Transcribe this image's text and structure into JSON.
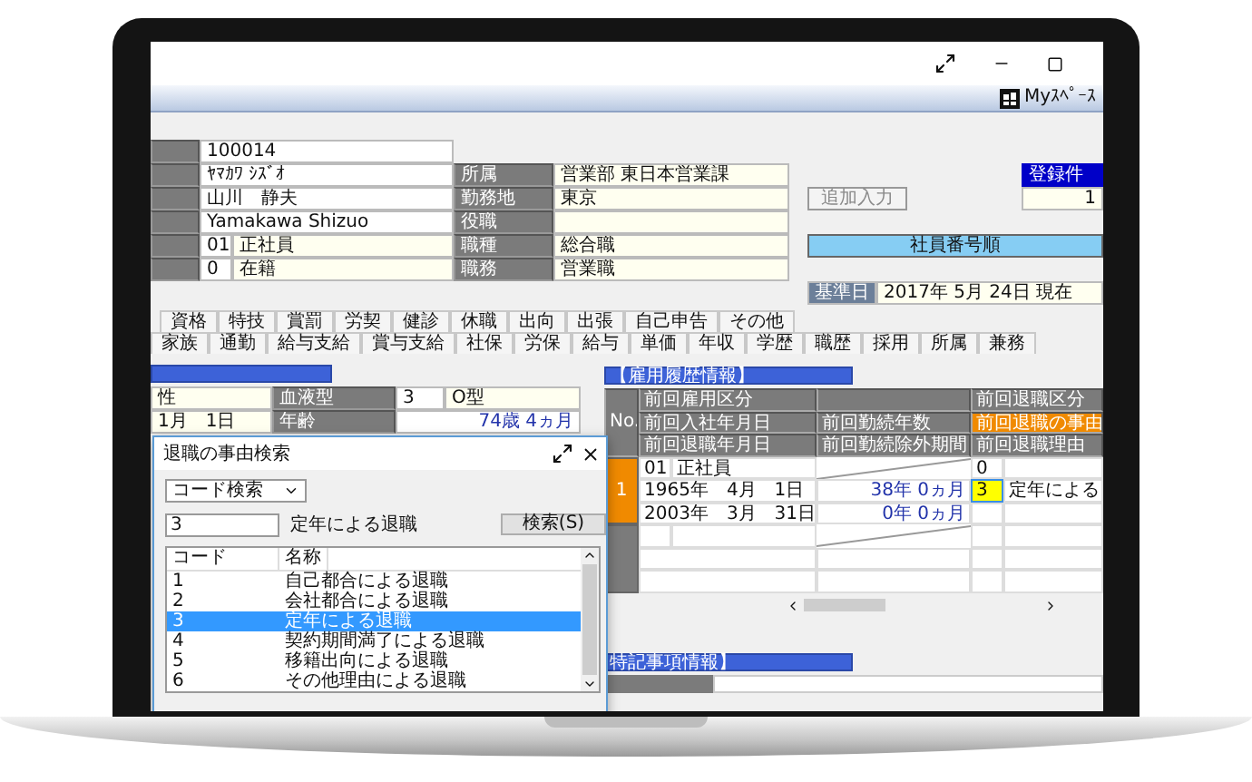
{
  "toolbar": {
    "myspace": "Myｽﾍﾟｰｽ"
  },
  "employee": {
    "code": "100014",
    "rows": [
      {
        "value": "ﾔﾏｶﾜ ｼｽﾞｵ",
        "label": "所属",
        "detail": "営業部 東日本営業課"
      },
      {
        "value": "山川　静夫",
        "label": "勤務地",
        "detail": "東京"
      },
      {
        "value": "Yamakawa Shizuo",
        "label": "役職"
      },
      {
        "code": "01",
        "value": "正社員",
        "label": "職種",
        "detail": "総合職"
      },
      {
        "code": "0",
        "value": "在籍",
        "label": "職務",
        "detail": "営業職"
      }
    ]
  },
  "side": {
    "add_button": {
      "label": "追加入力",
      "disabled": true
    },
    "count": {
      "label": "登録件",
      "value": "1"
    },
    "sort_button": "社員番号順",
    "base_date": {
      "label": "基準日",
      "value": "2017年 5月 24日 現在"
    }
  },
  "tabs": [
    [
      {
        "label": "資格",
        "selected": false
      },
      {
        "label": "特技",
        "selected": false
      },
      {
        "label": "賞罰",
        "selected": false
      },
      {
        "label": "労契",
        "selected": false
      },
      {
        "label": "健診",
        "selected": false
      },
      {
        "label": "休職",
        "selected": false
      },
      {
        "label": "出向",
        "selected": false
      },
      {
        "label": "出張",
        "selected": false
      },
      {
        "label": "自己申告",
        "selected": false
      },
      {
        "label": "その他",
        "selected": false
      }
    ],
    [
      {
        "label": "家族",
        "selected": false
      },
      {
        "label": "通勤",
        "selected": false
      },
      {
        "label": "給与支給",
        "selected": false
      },
      {
        "label": "賞与支給",
        "selected": false
      },
      {
        "label": "社保",
        "selected": false
      },
      {
        "label": "労保",
        "selected": false
      },
      {
        "label": "給与",
        "selected": false
      },
      {
        "label": "単価",
        "selected": false
      },
      {
        "label": "年収",
        "selected": false
      },
      {
        "label": "学歴",
        "selected": false
      },
      {
        "label": "職歴",
        "selected": false
      },
      {
        "label": "採用",
        "selected": false
      },
      {
        "label": "所属",
        "selected": false
      },
      {
        "label": "兼務",
        "selected": false
      }
    ]
  ],
  "personal": {
    "rows": [
      {
        "cells": [
          {
            "kind": "value",
            "text": "性"
          },
          {
            "kind": "label",
            "text": "血液型"
          },
          {
            "kind": "code",
            "text": "3"
          },
          {
            "kind": "value",
            "text": "O型"
          }
        ]
      },
      {
        "cells": [
          {
            "kind": "value",
            "text": "1月　1日"
          },
          {
            "kind": "label",
            "text": "年齢"
          },
          {
            "kind": "number",
            "text": "74歳 4ヵ月"
          }
        ]
      }
    ]
  },
  "employment_history": {
    "title": "【雇用履歴情報】",
    "no_heading": "No.",
    "headers": [
      [
        {
          "text": "前回雇用区分",
          "highlighted": false
        },
        {
          "highlighted": false
        },
        {
          "text": "前回退職区分",
          "highlighted": false
        }
      ],
      [
        {
          "text": "前回入社年月日",
          "highlighted": false
        },
        {
          "text": "前回勤続年数",
          "highlighted": false
        },
        {
          "text": "前回退職の事由",
          "highlighted": true
        }
      ],
      [
        {
          "text": "前回退職年月日",
          "highlighted": false
        },
        {
          "text": "前回勤続除外期間",
          "highlighted": false
        },
        {
          "text": "前回退職理由",
          "highlighted": false
        }
      ]
    ],
    "record": {
      "no": "1",
      "lines": [
        {
          "a_code": "01",
          "a": "正社員",
          "c_code": "0",
          "code_focused": false
        },
        {
          "a": "1965年　4月　1日",
          "b": "38年 0ヵ月",
          "c_code": "3",
          "code_focused": true,
          "c": "定年による"
        },
        {
          "a": "2003年　3月　31日",
          "b": "0年 0ヵ月",
          "code_focused": false
        }
      ]
    }
  },
  "notes": {
    "title": "特記事項情報】"
  },
  "search_dialog": {
    "title": "退職の事由検索",
    "mode": "コード検索",
    "query": "3",
    "query_name": "定年による退職",
    "search_button": "検索(S)",
    "columns": [
      "コード",
      "名称"
    ],
    "items": [
      {
        "code": "1",
        "name": "自己都合による退職",
        "selected": false
      },
      {
        "code": "2",
        "name": "会社都合による退職",
        "selected": false
      },
      {
        "code": "3",
        "name": "定年による退職",
        "selected": true
      },
      {
        "code": "4",
        "name": "契約期間満了による退職",
        "selected": false
      },
      {
        "code": "5",
        "name": "移籍出向による退職",
        "selected": false
      },
      {
        "code": "6",
        "name": "その他理由による退職",
        "selected": false
      }
    ]
  }
}
